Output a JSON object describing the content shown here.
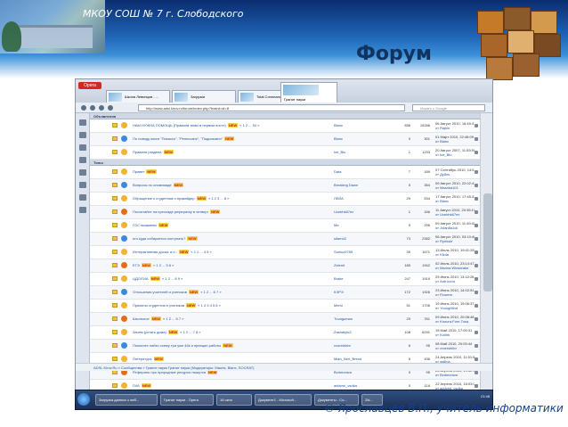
{
  "slide": {
    "school": "МКОУ СОШ № 7 г. Слободского",
    "title": "Форум",
    "credit": "© Ярославцев В.П., учитель информатики"
  },
  "browser": {
    "menu_button": "Opera",
    "tabs": [
      {
        "label": "Школа Левинцов - ..."
      },
      {
        "label": "Загрузки"
      },
      {
        "label": "Total Commander 7.5 ..."
      },
      {
        "label": "Гранит науки"
      }
    ],
    "url": "http://www.adsl.kirov.ru/forum/index.php?board=sh.8",
    "search_placeholder": "Искать с Google"
  },
  "forum": {
    "announcements_header": "Объявления",
    "topics_header": "Темы",
    "announcements": [
      {
        "title": "НАМ НУЖНА ПОМОЩЬ (Правила темы в первом посте)",
        "pages": "« 1 2 ... 54 »",
        "author": "Blanc",
        "replies": "836",
        "views": "15286",
        "last": "06 Август 2010, 16:45:37",
        "last_by": "от Rajkin"
      },
      {
        "title": "По поводу книги \"Пикассо\", \"Ренессанс\", \"Подсказано\"",
        "pages": "",
        "author": "Blanc",
        "replies": "0",
        "views": "301",
        "last": "01 Март 2010, 22:46:09",
        "last_by": "от Blanc"
      },
      {
        "title": "Правила раздела",
        "pages": "",
        "author": "Ice_Blu",
        "replies": "1",
        "views": "1233",
        "last": "20 Август 2007, 11:53:59",
        "last_by": "от Ice_Blu"
      }
    ],
    "topics": [
      {
        "title": "Привет",
        "pages": "",
        "author": "Data",
        "replies": "7",
        "views": "189",
        "last": "07 Сентябрь 2010, 14:51:19",
        "last_by": "от Дубль"
      },
      {
        "title": "Вопросы по олимпиаде",
        "pages": "",
        "author": "Breaking Dawn",
        "replies": "5",
        "views": "354",
        "last": "09 Август 2010, 22:02:47",
        "last_by": "от Mashka101"
      },
      {
        "title": "Обращение к студентам и провайдер",
        "pages": "« 1 2 3 ... 8 »",
        "author": "ЛЕЙА",
        "replies": "29",
        "views": "534",
        "last": "17 Август 2010, 17:45:31",
        "last_by": "от Blanc"
      },
      {
        "title": "Посчитайте на прессаде рефератку в четверг",
        "pages": "",
        "author": "Ucebhk67ex",
        "replies": "1",
        "views": "166",
        "last": "11 Август 2010, 20:35:19",
        "last_by": "от Ucebhk67ex"
      },
      {
        "title": "ГОС.экзамены",
        "pages": "",
        "author": "Me",
        "replies": "5",
        "views": "295",
        "last": "09 Август 2010, 11:49:42",
        "last_by": "от Jolan8a1ck"
      },
      {
        "title": "кто куда собирается поступать?",
        "pages": "",
        "author": "sitam42",
        "replies": "73",
        "views": "2382",
        "last": "06 Август 2010, 03:10:49",
        "last_by": "от Ryriksle"
      },
      {
        "title": "Интерактивная доска: я и -",
        "pages": "« 1 2 ... 4 5 »",
        "author": "Sunluz9789",
        "replies": "39",
        "views": "1671",
        "last": "13 Июль 2010, 19:41:28",
        "last_by": "от Klinia"
      },
      {
        "title": "ЕГЭ",
        "pages": "« 1 2 ... 5 6 »",
        "author": "Zelenit",
        "replies": "185",
        "views": "1942",
        "last": "02 Июль 2010, 23:14:47",
        "last_by": "от Marina Winsdrake"
      },
      {
        "title": "ЦДО/ГИА",
        "pages": "« 1 2 ... 8 9 »",
        "author": "Brake",
        "replies": "247",
        "views": "1919",
        "last": "25 Июнь 2010, 13:12:26",
        "last_by": "от Anb kuhn"
      },
      {
        "title": "Отношения учителей и учеников",
        "pages": "« 1 2 ... 6 7 »",
        "author": "КЭРЭ",
        "replies": "172",
        "views": "1926",
        "last": "23 Июнь 2010, 14:02:51",
        "last_by": "от Flowers"
      },
      {
        "title": "Прямоты студентов и учеников",
        "pages": "« 1 2 3 4 5 6 »",
        "author": "Memi",
        "replies": "51",
        "views": "1706",
        "last": "19 Июнь 2010, 19:06:37",
        "last_by": "от YoungMind"
      },
      {
        "title": "Школьное",
        "pages": "« 1 2 ... 6 7 »",
        "author": "Tuvaguman",
        "replies": "29",
        "views": "761",
        "last": "09 Июнь 2010, 20:08:48",
        "last_by": "от Knoura-Fom-Tosa"
      },
      {
        "title": "Зачем (устать дома)",
        "pages": "« 1 2 ... 7 8 »",
        "author": "Zashatylu2",
        "replies": "108",
        "views": "6291",
        "last": "15 Май 2010, 17:09:31",
        "last_by": "от Kollirk"
      },
      {
        "title": "Помогите найти схему три уже 4бк и принцип работы",
        "pages": "",
        "author": "cvonivkkbr",
        "replies": "6",
        "views": "95",
        "last": "08 Май 2010, 20:03:44",
        "last_by": "от cvonivkkbr"
      },
      {
        "title": "Литература",
        "pages": "",
        "author": "Main_Neri_Brend",
        "replies": "6",
        "views": "436",
        "last": "24 Апрель 2010, 11:51:59",
        "last_by": "от gallina"
      },
      {
        "title": "Рефераты про природные ресурсы пишутся",
        "pages": "",
        "author": "Bvdmonwa",
        "replies": "0",
        "views": "95",
        "last": "28 Апрель 2010, 19:42:32",
        "last_by": "от Bvdmonwa"
      },
      {
        "title": "ГИА",
        "pages": "",
        "author": "addvrni_vsdka",
        "replies": "0",
        "views": "116",
        "last": "22 Апрель 2010, 16:03:09",
        "last_by": "от addvrni_vsdka"
      }
    ],
    "pager": "Страниц: [1] 2 3 Вверх",
    "legend": "ADSL.Kirov.Ru » Сообщества » Гранит науки    Гранит науки (Модераторы: Mauris, Blanc, SOCRAT)",
    "new_badge": "NEW"
  },
  "taskbar": {
    "start": "",
    "buttons": [
      {
        "label": "Загрузка данных с веб..."
      },
      {
        "label": "Гранит науки - Opera"
      },
      {
        "label": "16 окно"
      },
      {
        "label": "Документ1 - Microsoft..."
      },
      {
        "label": "Документы - Со..."
      },
      {
        "label": "Zkl..."
      }
    ],
    "clock": "21:48"
  },
  "colors": {
    "header_dark": "#0a2d70",
    "header_mid": "#1e63b5",
    "title": "#12335f",
    "link": "#2255a4",
    "new_badge_bg": "#f4d24a",
    "opera_red": "#d02a24"
  }
}
